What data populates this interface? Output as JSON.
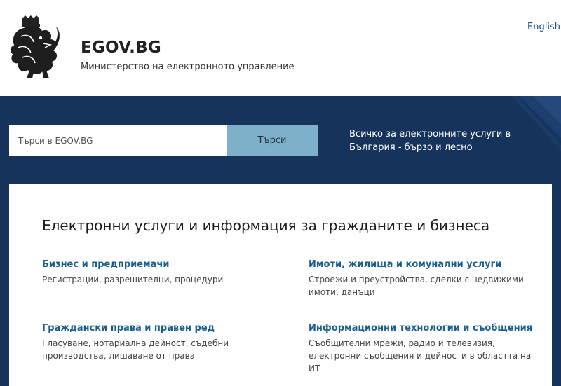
{
  "header": {
    "site_title": "EGOV.BG",
    "site_subtitle": "Министерство на електронното управление",
    "language_link": "English",
    "logo_icon": "lion-coat-of-arms-icon"
  },
  "search": {
    "placeholder": "Търси в EGOV.BG",
    "button_label": "Търси"
  },
  "tagline": "Всичко за електронните услуги в България - бързо и лесно",
  "colors": {
    "banner_bg": "#16335c",
    "search_button_bg": "#7fb0c9",
    "link": "#1a5d8f"
  },
  "section": {
    "title": "Електронни услуги и информация за гражданите и бизнеса",
    "categories": [
      {
        "title": "Бизнес и предприемачи",
        "description": "Регистрации, разрешителни, процедури"
      },
      {
        "title": "Имоти, жилища и комунални услуги",
        "description": "Строежи и преустройства, сделки с недвижими имоти, данъци"
      },
      {
        "title": "Граждански права и правен ред",
        "description": "Гласуване, нотариална дейност, съдебни производства, лишаване от права"
      },
      {
        "title": "Информационни технологии и съобщения",
        "description": "Съобщителни мрежи, радио и телевизия, електронни съобщения и дейности в областта на ИТ"
      }
    ]
  }
}
